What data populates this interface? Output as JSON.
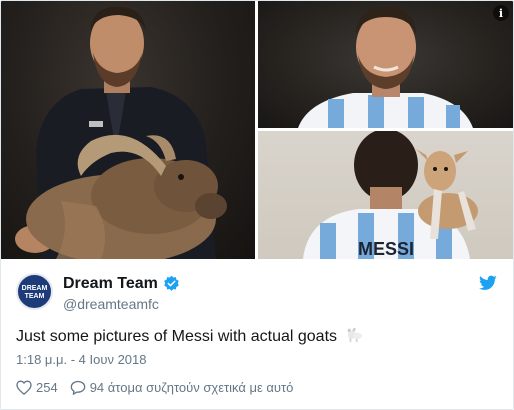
{
  "account": {
    "display_name": "Dream Team",
    "handle": "@dreamteamfc",
    "avatar_line1": "DREAM",
    "avatar_line2": "TEAM"
  },
  "tweet": {
    "text": "Just some pictures of Messi with actual goats",
    "timestamp": "1:18 μ.μ. - 4 Ιουν 2018",
    "likes": "254",
    "replies_text": "94 άτομα συζητούν σχετικά με αυτό"
  },
  "media": {
    "jersey_text": "MESSI",
    "info_icon": "i"
  },
  "colors": {
    "twitter_blue": "#1da1f2",
    "secondary_text": "#657786",
    "primary_text": "#14171a",
    "argentina_blue": "#75aadb"
  }
}
